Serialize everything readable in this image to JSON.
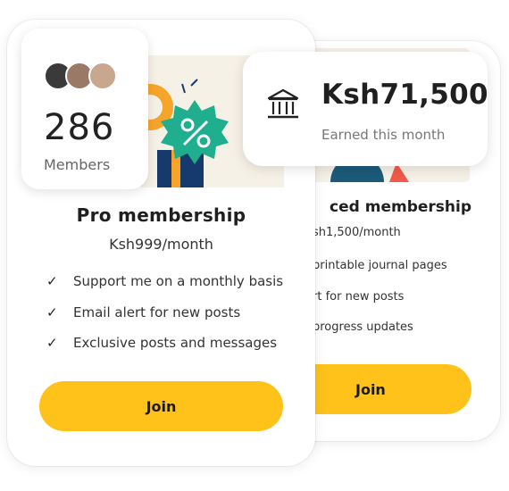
{
  "advanced_card": {
    "title": "ced membership",
    "price": "sh1,500/month",
    "features": [
      "printable journal pages",
      "rt for new posts",
      "progress updates"
    ],
    "join_label": "Join"
  },
  "pro_card": {
    "title": "Pro membership",
    "price": "Ksh999/month",
    "features": [
      "Support me on a monthly basis",
      "Email alert for new posts",
      "Exclusive posts and messages"
    ],
    "join_label": "Join"
  },
  "members": {
    "count": "286",
    "label": "Members"
  },
  "earnings": {
    "amount": "Ksh71,500",
    "label": "Earned this month",
    "icon": "bank-icon"
  },
  "colors": {
    "accent": "#ffc21a",
    "banner_bg": "#f6f1e7",
    "teal": "#1fae8e",
    "orange": "#f7a52a",
    "navy": "#153a6b"
  }
}
